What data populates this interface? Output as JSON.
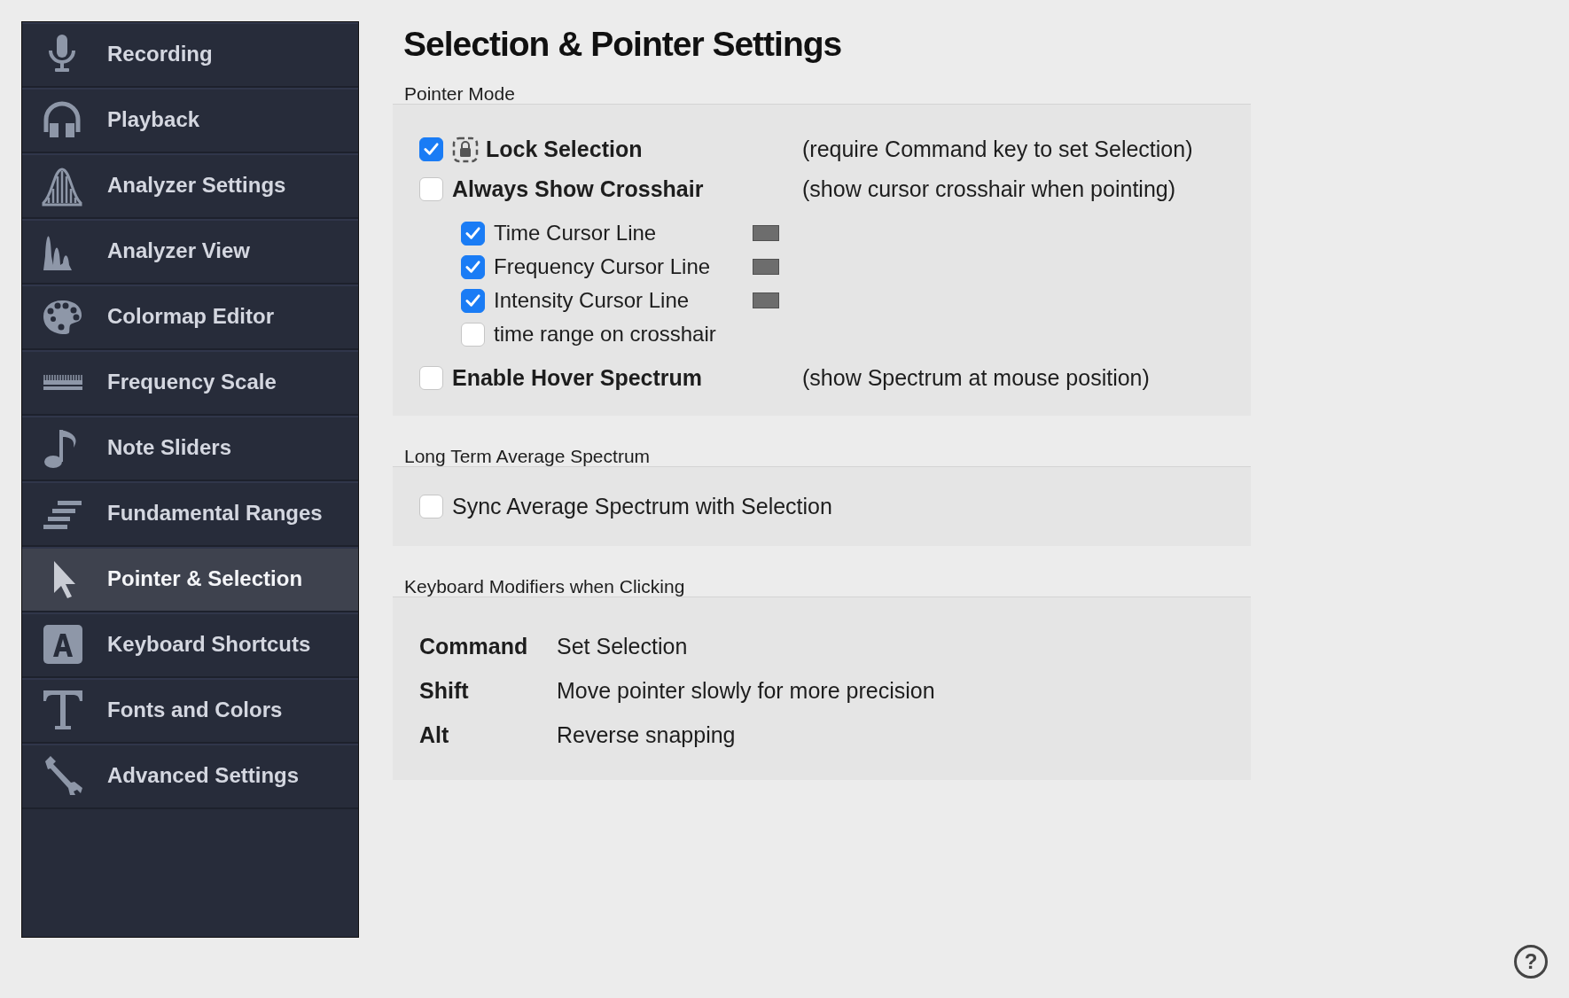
{
  "sidebar": {
    "items": [
      {
        "label": "Recording",
        "selected": false
      },
      {
        "label": "Playback",
        "selected": false
      },
      {
        "label": "Analyzer Settings",
        "selected": false
      },
      {
        "label": "Analyzer View",
        "selected": false
      },
      {
        "label": "Colormap Editor",
        "selected": false
      },
      {
        "label": "Frequency Scale",
        "selected": false
      },
      {
        "label": "Note Sliders",
        "selected": false
      },
      {
        "label": "Fundamental Ranges",
        "selected": false
      },
      {
        "label": "Pointer & Selection",
        "selected": true
      },
      {
        "label": "Keyboard Shortcuts",
        "selected": false
      },
      {
        "label": "Fonts and Colors",
        "selected": false
      },
      {
        "label": "Advanced Settings",
        "selected": false
      }
    ]
  },
  "title": "Selection & Pointer Settings",
  "pointer_mode": {
    "label": "Pointer Mode",
    "options": [
      {
        "label": "Lock Selection",
        "checked": true,
        "description": "(require Command key to set Selection)"
      },
      {
        "label": "Always Show Crosshair",
        "checked": false,
        "description": "(show cursor crosshair when pointing)",
        "children": [
          {
            "label": "Time Cursor Line",
            "checked": true,
            "swatch": true
          },
          {
            "label": "Frequency Cursor Line",
            "checked": true,
            "swatch": true
          },
          {
            "label": "Intensity Cursor Line",
            "checked": true,
            "swatch": true
          },
          {
            "label": "time range on crosshair",
            "checked": false,
            "swatch": false
          }
        ]
      },
      {
        "label": "Enable Hover Spectrum",
        "checked": false,
        "description": "(show Spectrum at mouse position)"
      }
    ]
  },
  "long_term_average": {
    "label": "Long Term Average Spectrum",
    "options": [
      {
        "label": "Sync Average Spectrum with Selection",
        "checked": false
      }
    ]
  },
  "keyboard_modifiers": {
    "label": "Keyboard Modifiers when Clicking",
    "rows": [
      {
        "key": "Command",
        "action": "Set Selection"
      },
      {
        "key": "Shift",
        "action": "Move pointer slowly for more precision"
      },
      {
        "key": "Alt",
        "action": "Reverse snapping"
      }
    ]
  },
  "help_button": {
    "label": "?"
  }
}
